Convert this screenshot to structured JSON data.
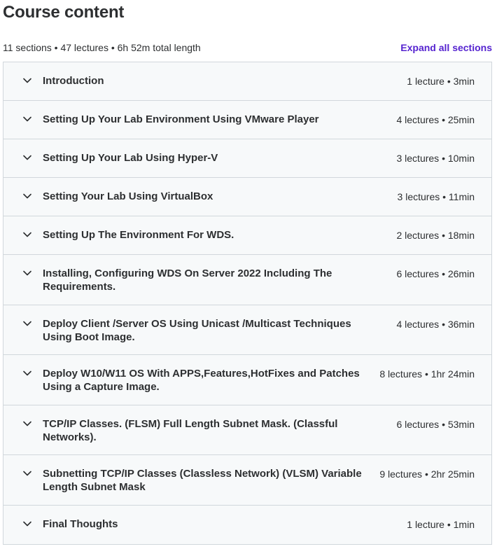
{
  "header": {
    "title": "Course content"
  },
  "summary": {
    "text": "11 sections • 47 lectures • 6h 52m total length",
    "expand_label": "Expand all sections"
  },
  "colors": {
    "accent": "#5624d0",
    "section_bg": "#f7f9fa",
    "border": "#d1d7dc",
    "text": "#2d2f31"
  },
  "icons": {
    "section_toggle": "chevron-down-icon"
  },
  "sections": [
    {
      "title": "Introduction",
      "meta": "1 lecture • 3min"
    },
    {
      "title": "Setting Up Your Lab Environment Using VMware Player",
      "meta": "4 lectures • 25min"
    },
    {
      "title": "Setting Up Your Lab Using Hyper-V",
      "meta": "3 lectures • 10min"
    },
    {
      "title": "Setting Your Lab Using VirtualBox",
      "meta": "3 lectures • 11min"
    },
    {
      "title": "Setting Up The Environment For WDS.",
      "meta": "2 lectures • 18min"
    },
    {
      "title": "Installing, Configuring WDS On Server 2022 Including The Requirements.",
      "meta": "6 lectures • 26min"
    },
    {
      "title": "Deploy Client /Server OS Using Unicast /Multicast Techniques Using Boot Image.",
      "meta": "4 lectures • 36min"
    },
    {
      "title": "Deploy W10/W11 OS With APPS,Features,HotFixes and Patches Using a Capture Image.",
      "meta": "8 lectures • 1hr 24min"
    },
    {
      "title": "TCP/IP Classes. (FLSM) Full Length Subnet Mask. (Classful Networks).",
      "meta": "6 lectures • 53min"
    },
    {
      "title": "Subnetting TCP/IP Classes (Classless Network) (VLSM) Variable Length Subnet Mask",
      "meta": "9 lectures • 2hr 25min"
    },
    {
      "title": "Final Thoughts",
      "meta": "1 lecture • 1min"
    }
  ]
}
